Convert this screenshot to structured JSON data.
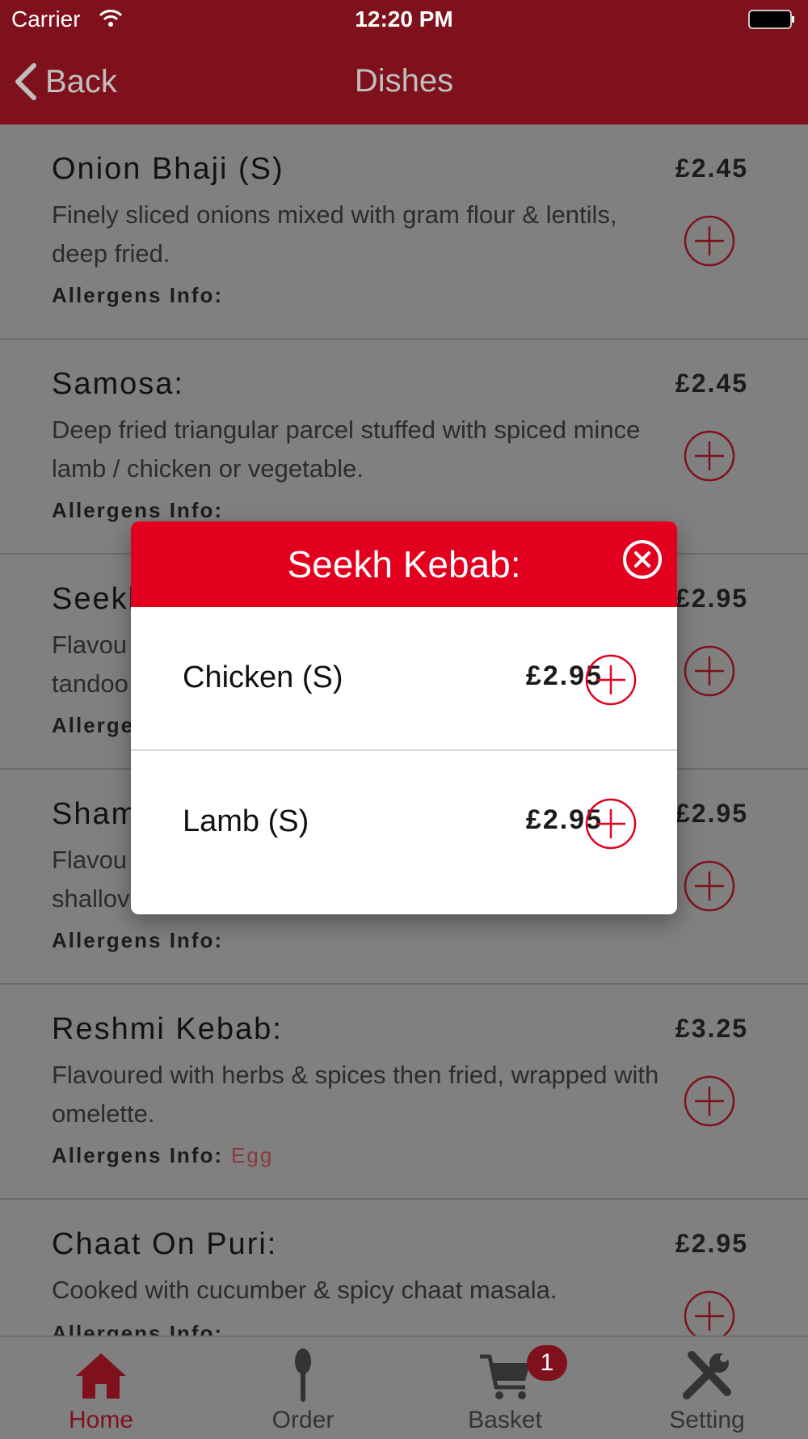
{
  "status_bar": {
    "carrier": "Carrier",
    "time": "12:20 PM"
  },
  "nav": {
    "back_label": "Back",
    "title": "Dishes"
  },
  "colors": {
    "brand_dark": "#7e111c",
    "brand_red": "#e3001f",
    "overlay_gray": "#808080"
  },
  "dishes": [
    {
      "name": "Onion Bhaji (S)",
      "desc": "Finely sliced onions mixed with gram flour & lentils, deep fried.",
      "allergen_label": "Allergens Info:",
      "allergen_value": "",
      "price": "£2.45"
    },
    {
      "name": "Samosa:",
      "desc": "Deep fried triangular parcel stuffed with spiced mince lamb / chicken or vegetable.",
      "allergen_label": "Allergens Info:",
      "allergen_value": "",
      "price": "£2.45"
    },
    {
      "name": "Seekh",
      "desc": "Flavou tandoo",
      "allergen_label": "Allerge",
      "allergen_value": "",
      "price": "£2.95"
    },
    {
      "name": "Sham",
      "desc": "Flavou shallov",
      "allergen_label": "Allergens Info:",
      "allergen_value": "",
      "price": "£2.95"
    },
    {
      "name": "Reshmi Kebab:",
      "desc": "Flavoured with herbs & spices then fried, wrapped with omelette.",
      "allergen_label": "Allergens Info:",
      "allergen_value": "Egg",
      "price": "£3.25"
    },
    {
      "name": "Chaat On Puri:",
      "desc": "Cooked with cucumber & spicy chaat masala.",
      "allergen_label": "Allergens Info:",
      "allergen_value": "",
      "price": "£2.95"
    }
  ],
  "modal": {
    "title": "Seekh Kebab:",
    "options": [
      {
        "name": "Chicken (S)",
        "price": "£2.95"
      },
      {
        "name": "Lamb (S)",
        "price": "£2.95"
      }
    ]
  },
  "tabbar": {
    "tabs": [
      {
        "label": "Home",
        "icon": "home-icon",
        "active": true
      },
      {
        "label": "Order",
        "icon": "spoon-icon",
        "active": false
      },
      {
        "label": "Basket",
        "icon": "cart-icon",
        "active": false
      },
      {
        "label": "Setting",
        "icon": "tools-icon",
        "active": false
      }
    ],
    "basket_badge": "1"
  }
}
